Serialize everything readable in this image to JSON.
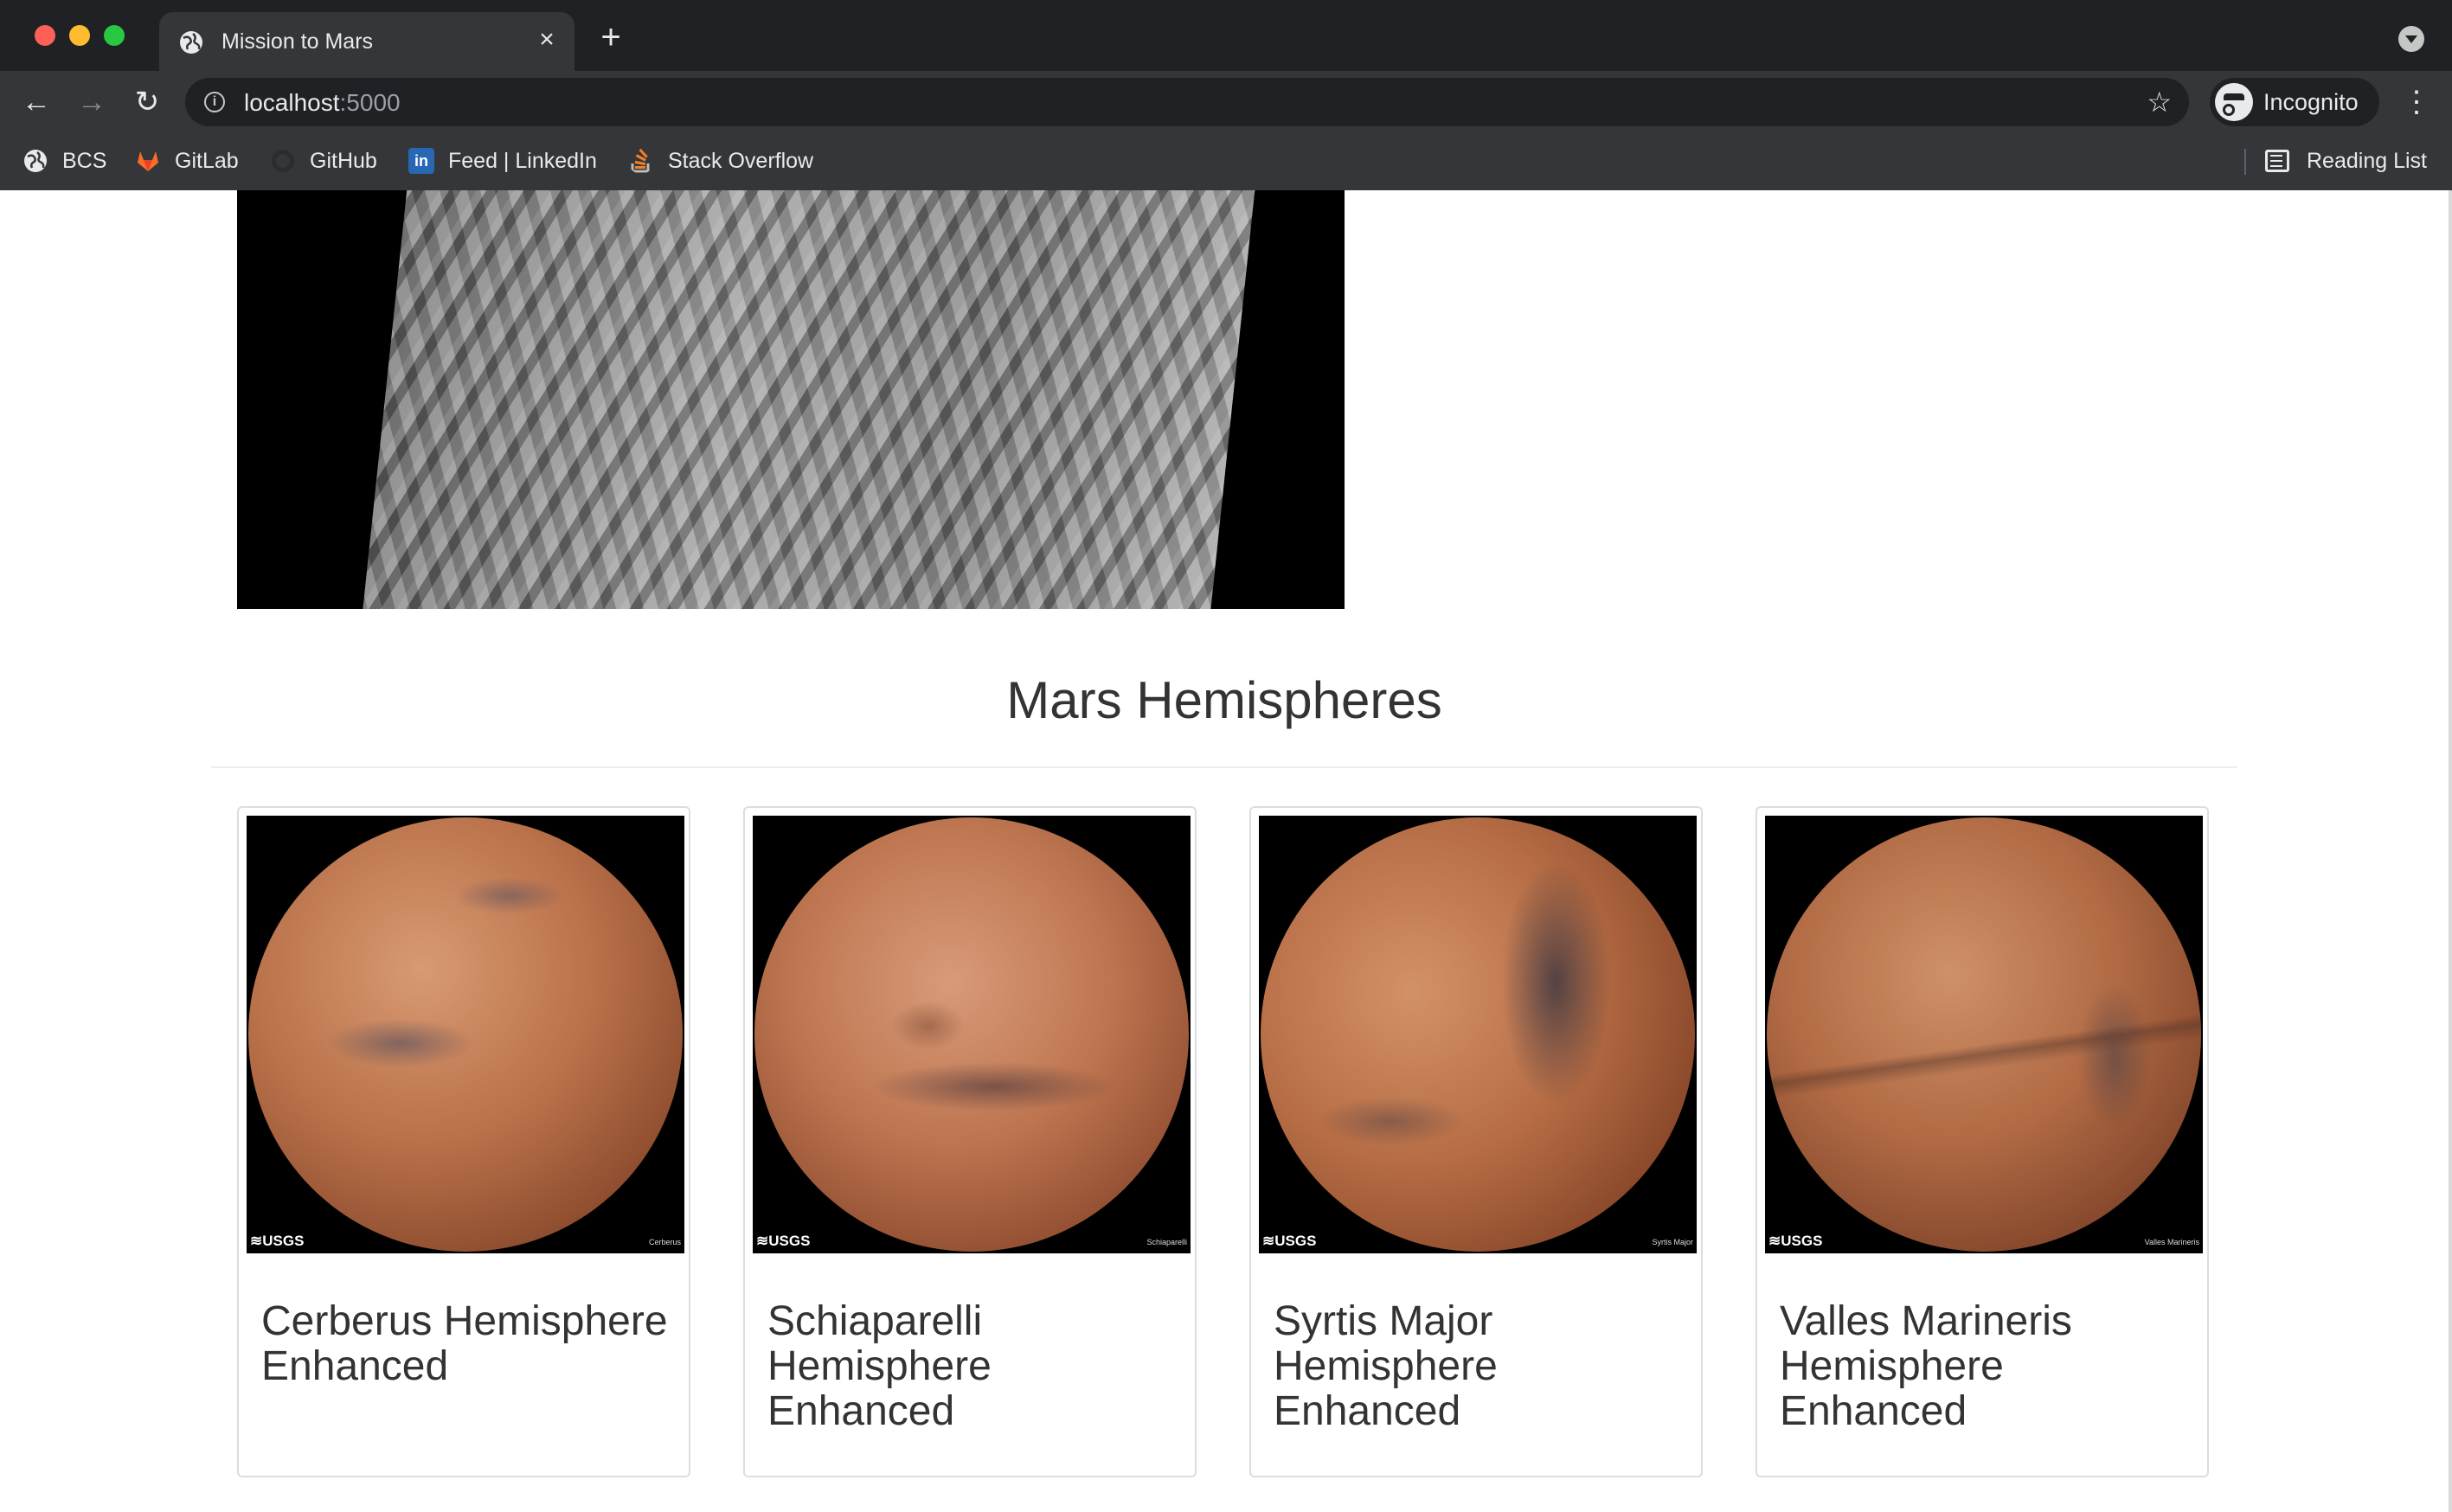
{
  "browser": {
    "tab_title": "Mission to Mars",
    "tab_close": "×",
    "new_tab": "+",
    "url_host": "localhost",
    "url_port": ":5000",
    "profile_label": "Incognito",
    "back": "←",
    "forward": "→",
    "reload": "↻",
    "star": "☆",
    "menu": "⋮"
  },
  "bookmarks": {
    "items": [
      {
        "label": "BCS",
        "icon": "globe-icon"
      },
      {
        "label": "GitLab",
        "icon": "gitlab-icon"
      },
      {
        "label": "GitHub",
        "icon": "github-icon"
      },
      {
        "label": "Feed | LinkedIn",
        "icon": "linkedin-icon"
      },
      {
        "label": "Stack Overflow",
        "icon": "stackoverflow-icon"
      }
    ],
    "reading_list": "Reading List"
  },
  "page": {
    "section_title": "Mars Hemispheres",
    "hemispheres": [
      {
        "title": "Cerberus Hemisphere Enhanced",
        "caption": "Cerberus"
      },
      {
        "title": "Schiaparelli Hemisphere Enhanced",
        "caption": "Schiaparelli"
      },
      {
        "title": "Syrtis Major Hemisphere Enhanced",
        "caption": "Syrtis Major"
      },
      {
        "title": "Valles Marineris Hemisphere Enhanced",
        "caption": "Valles Marineris"
      }
    ],
    "usgs_label": "≋USGS"
  },
  "colors": {
    "chrome_dark": "#202124",
    "chrome_toolbar": "#35363a",
    "mars": "#b5704a"
  }
}
